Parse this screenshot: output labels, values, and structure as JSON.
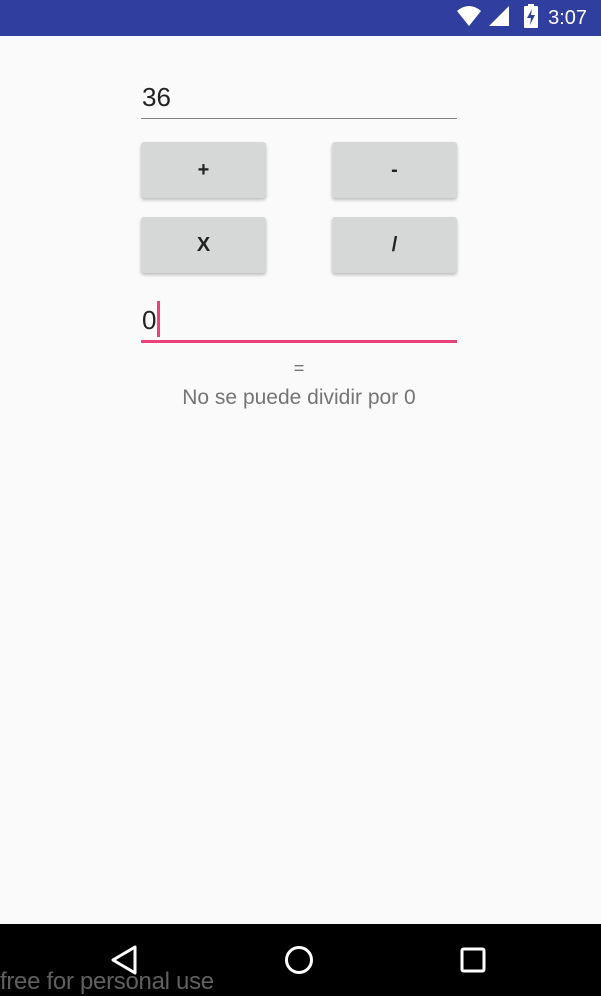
{
  "status_bar": {
    "time": "3:07",
    "icons": [
      "wifi-icon",
      "cell-signal-icon",
      "battery-charging-icon"
    ],
    "background": "#303f9f"
  },
  "calculator": {
    "first_operand": "36",
    "second_operand": "0",
    "buttons": {
      "add": "+",
      "subtract": "-",
      "multiply": "X",
      "divide": "/"
    },
    "equals_sign": "=",
    "result_text": "No se puede dividir por 0"
  },
  "nav_bar": {
    "icons": [
      "back-icon",
      "home-icon",
      "recents-icon"
    ]
  },
  "watermark": "free for personal use",
  "colors": {
    "accent": "#ec407a",
    "button": "#d6d7d7",
    "background": "#fafafa"
  }
}
